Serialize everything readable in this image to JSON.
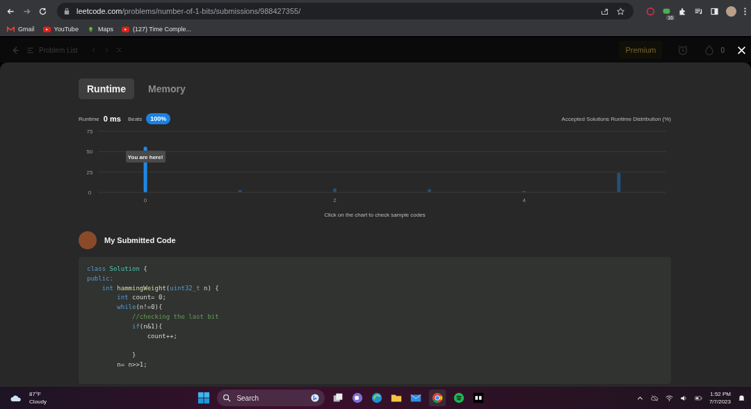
{
  "browser": {
    "url_domain": "leetcode.com",
    "url_path": "/problems/number-of-1-bits/submissions/988427355/",
    "extension_badge": "16",
    "bookmarks": [
      {
        "kind": "gmail",
        "label": "Gmail"
      },
      {
        "kind": "youtube",
        "label": "YouTube"
      },
      {
        "kind": "maps",
        "label": "Maps"
      },
      {
        "kind": "youtube",
        "label": "(127) Time Comple..."
      }
    ]
  },
  "nav": {
    "problem_list": "Problem List",
    "premium": "Premium",
    "streak": "0"
  },
  "tabs": [
    {
      "label": "Runtime",
      "selected": true
    },
    {
      "label": "Memory",
      "selected": false
    }
  ],
  "stats": {
    "runtime_label": "Runtime",
    "runtime_value": "0 ms",
    "beats_label": "Beats",
    "beats_value": "100%"
  },
  "chart_data": {
    "type": "bar",
    "title": "Accepted Solutions Runtime Distribution (%)",
    "x": [
      0,
      1,
      2,
      3,
      4,
      5
    ],
    "values": [
      56,
      3,
      5,
      4,
      2,
      24
    ],
    "xlim": [
      -0.5,
      5.5
    ],
    "ylim": [
      0,
      75
    ],
    "xticks": [
      0,
      2,
      4
    ],
    "yticks": [
      0,
      25,
      50,
      75
    ],
    "annotations": [
      {
        "x": 0,
        "text": "You are here!"
      }
    ]
  },
  "chart_hint": "Click on the chart to check sample codes",
  "submitted": {
    "title": "My Submitted Code",
    "lines": [
      {
        "kind": "code",
        "tokens": [
          {
            "kind": "kw",
            "text": "class"
          },
          {
            "kind": "type",
            "text": " Solution"
          },
          {
            "kind": "plain",
            "text": " {"
          }
        ]
      },
      {
        "kind": "code",
        "tokens": [
          {
            "kind": "kw",
            "text": "public:"
          }
        ]
      },
      {
        "kind": "code",
        "tokens": [
          {
            "kind": "kw",
            "text": "    int"
          },
          {
            "kind": "fn",
            "text": " hammingWeight"
          },
          {
            "kind": "plain",
            "text": "("
          },
          {
            "kind": "kw",
            "text": "uint32_t"
          },
          {
            "kind": "plain",
            "text": " n) {"
          }
        ]
      },
      {
        "kind": "code",
        "tokens": [
          {
            "kind": "kw",
            "text": "        int"
          },
          {
            "kind": "plain",
            "text": " count= 0;"
          }
        ]
      },
      {
        "kind": "code",
        "tokens": [
          {
            "kind": "kw",
            "text": "        while"
          },
          {
            "kind": "plain",
            "text": "(n!=0){"
          }
        ]
      },
      {
        "kind": "code",
        "tokens": [
          {
            "kind": "comment",
            "text": "            //checking the last bit"
          }
        ]
      },
      {
        "kind": "code",
        "tokens": [
          {
            "kind": "kw",
            "text": "            if"
          },
          {
            "kind": "plain",
            "text": "(n&1){"
          }
        ]
      },
      {
        "kind": "code",
        "tokens": [
          {
            "kind": "plain",
            "text": "                count++;"
          }
        ]
      },
      {
        "kind": "blank"
      },
      {
        "kind": "code",
        "tokens": [
          {
            "kind": "plain",
            "text": "            }"
          }
        ]
      },
      {
        "kind": "code",
        "tokens": [
          {
            "kind": "plain",
            "text": "        n= n>>1;"
          }
        ]
      }
    ]
  },
  "taskbar": {
    "temperature": "87°F",
    "weather": "Cloudy",
    "search_placeholder": "Search",
    "time": "1:52 PM",
    "date": "7/7/2023"
  }
}
